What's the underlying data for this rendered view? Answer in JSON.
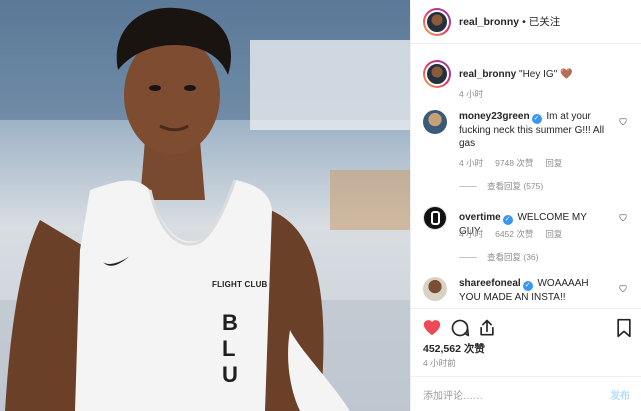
{
  "post": {
    "username": "real_bronny",
    "separator": "•",
    "follow_status": "已关注",
    "jersey_brand": "FLIGHT CLUB",
    "jersey_text": "BLU"
  },
  "caption": {
    "username": "real_bronny",
    "text": "\"Hey IG\" 🤎",
    "time": "4 小时"
  },
  "comments": [
    {
      "username": "money23green",
      "text": "Im at your fucking neck this summer G!!! All gas",
      "time": "4 小时",
      "likes": "9748 次赞",
      "reply": "回复",
      "view_replies": "查看回复 (575)"
    },
    {
      "username": "overtime",
      "text": "WELCOME MY GUY",
      "time": "4 小时",
      "likes": "6452 次赞",
      "reply": "回复",
      "view_replies": "查看回复 (36)"
    },
    {
      "username": "shareefoneal",
      "text": "WOAAAAH YOU MADE AN INSTA!!"
    }
  ],
  "likes_count": "452,562 次赞",
  "post_time": "4 小时前",
  "add_comment": {
    "placeholder": "添加评论……",
    "post_label": "发布"
  },
  "colors": {
    "like_red": "#ed4956",
    "verified_blue": "#3897f0",
    "post_disabled": "#b2dffc"
  },
  "icons": [
    "heart-icon",
    "comment-icon",
    "share-icon",
    "bookmark-icon",
    "verified-icon"
  ]
}
